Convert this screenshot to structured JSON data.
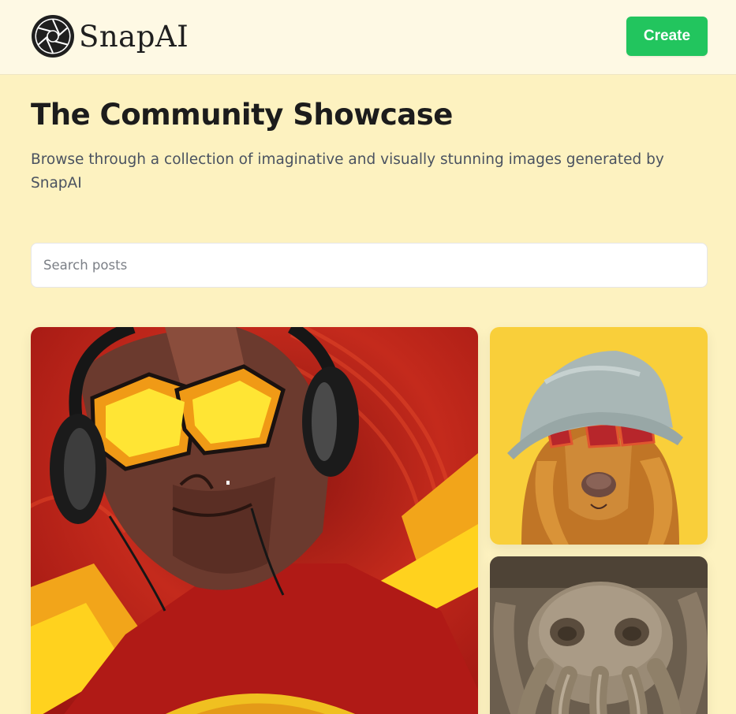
{
  "header": {
    "brand": "SnapAI",
    "logo_icon": "camera-aperture-icon",
    "create_label": "Create",
    "accent": "#22c55e"
  },
  "main": {
    "title": "The Community Showcase",
    "description": "Browse through a collection of imaginative and visually stunning images generated by SnapAI"
  },
  "search": {
    "placeholder": "Search posts",
    "value": ""
  },
  "posts": [
    {
      "name": "hero-with-headphones-image"
    },
    {
      "name": "dog-with-sunglasses-image"
    },
    {
      "name": "sand-octopus-image"
    }
  ],
  "colors": {
    "background": "#fdf2c0",
    "header": "#fef9e4",
    "button": "#22c55e"
  }
}
